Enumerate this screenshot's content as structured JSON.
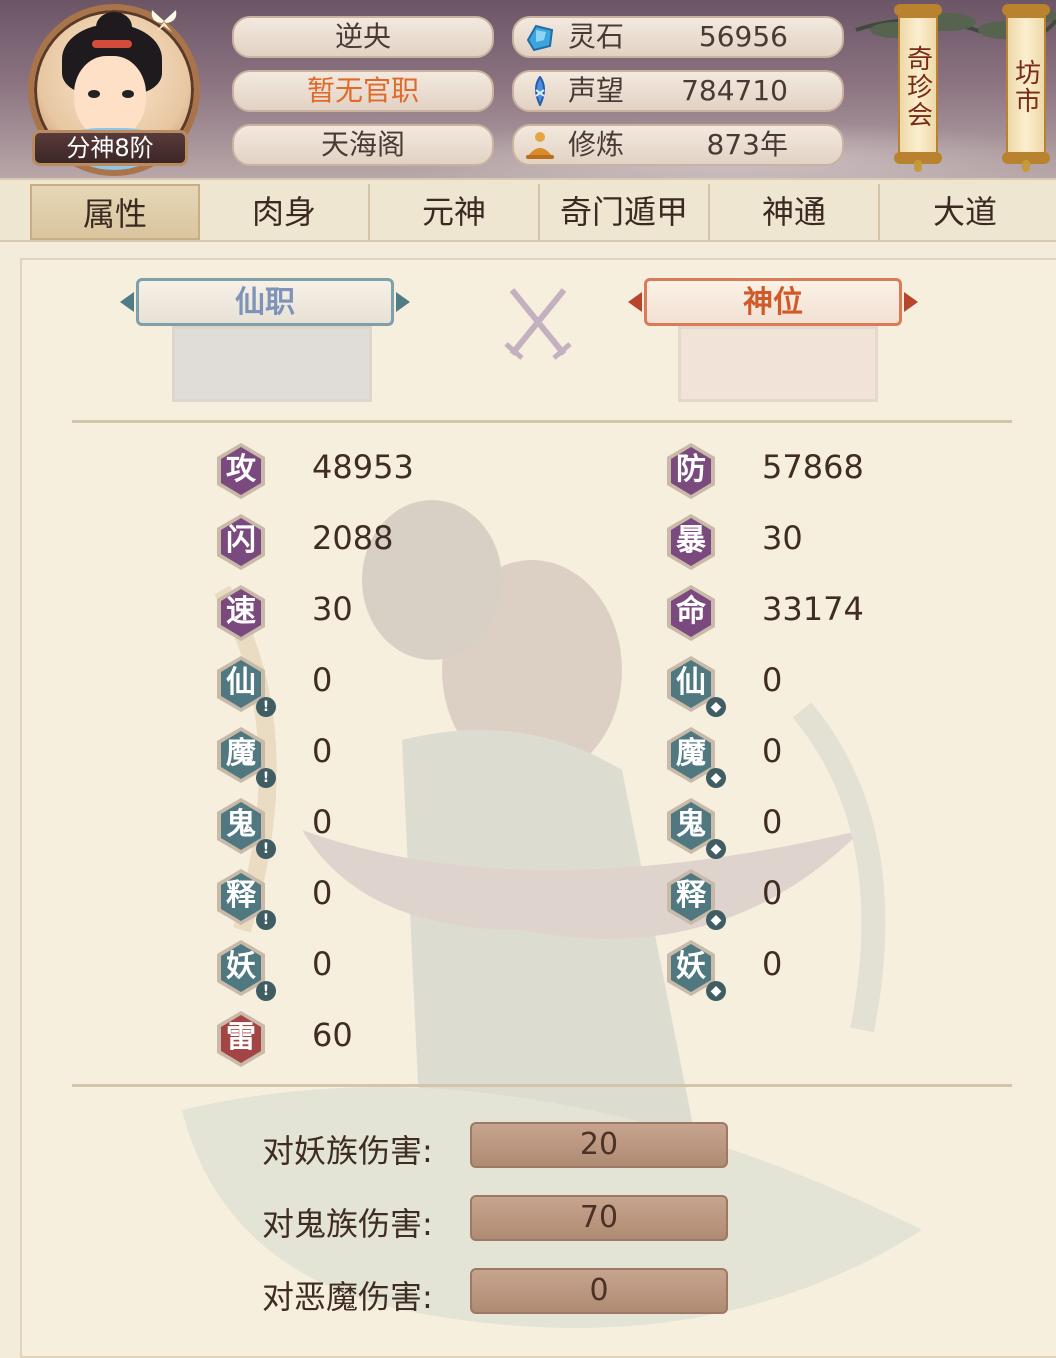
{
  "header": {
    "avatar_rank": "分神8阶",
    "player_name": "逆央",
    "official_title": "暂无官职",
    "sect": "天海阁",
    "resources": [
      {
        "icon": "spirit-stone-icon",
        "label": "灵石",
        "value": "56956"
      },
      {
        "icon": "prestige-icon",
        "label": "声望",
        "value": "784710"
      },
      {
        "icon": "cultivation-icon",
        "label": "修炼",
        "value": "873年"
      }
    ],
    "scroll_buttons": [
      {
        "name": "treasure-fair-button",
        "label": "奇珍会"
      },
      {
        "name": "market-button",
        "label": "坊市"
      }
    ]
  },
  "tabs": [
    "属性",
    "肉身",
    "元神",
    "奇门遁甲",
    "神通",
    "大道"
  ],
  "active_tab": "属性",
  "titles": {
    "immortal_post": "仙职",
    "divine_rank": "神位"
  },
  "stats_left": [
    {
      "glyph": "攻",
      "value": "48953",
      "type": "purple"
    },
    {
      "glyph": "闪",
      "value": "2088",
      "type": "purple"
    },
    {
      "glyph": "速",
      "value": "30",
      "type": "purple"
    },
    {
      "glyph": "仙",
      "value": "0",
      "type": "teal-attack"
    },
    {
      "glyph": "魔",
      "value": "0",
      "type": "teal-attack"
    },
    {
      "glyph": "鬼",
      "value": "0",
      "type": "teal-attack"
    },
    {
      "glyph": "释",
      "value": "0",
      "type": "teal-attack"
    },
    {
      "glyph": "妖",
      "value": "0",
      "type": "teal-attack"
    },
    {
      "glyph": "雷",
      "value": "60",
      "type": "red"
    }
  ],
  "stats_right": [
    {
      "glyph": "防",
      "value": "57868",
      "type": "purple"
    },
    {
      "glyph": "暴",
      "value": "30",
      "type": "purple"
    },
    {
      "glyph": "命",
      "value": "33174",
      "type": "purple"
    },
    {
      "glyph": "仙",
      "value": "0",
      "type": "teal-defense"
    },
    {
      "glyph": "魔",
      "value": "0",
      "type": "teal-defense"
    },
    {
      "glyph": "鬼",
      "value": "0",
      "type": "teal-defense"
    },
    {
      "glyph": "释",
      "value": "0",
      "type": "teal-defense"
    },
    {
      "glyph": "妖",
      "value": "0",
      "type": "teal-defense"
    }
  ],
  "damage_bonuses": [
    {
      "label": "对妖族伤害:",
      "value": "20"
    },
    {
      "label": "对鬼族伤害:",
      "value": "70"
    },
    {
      "label": "对恶魔伤害:",
      "value": "0"
    }
  ],
  "colors": {
    "badge_purple": "#7a4a7e",
    "badge_teal": "#4f7880",
    "badge_red": "#a34545",
    "bar_fill": "#b99680"
  }
}
